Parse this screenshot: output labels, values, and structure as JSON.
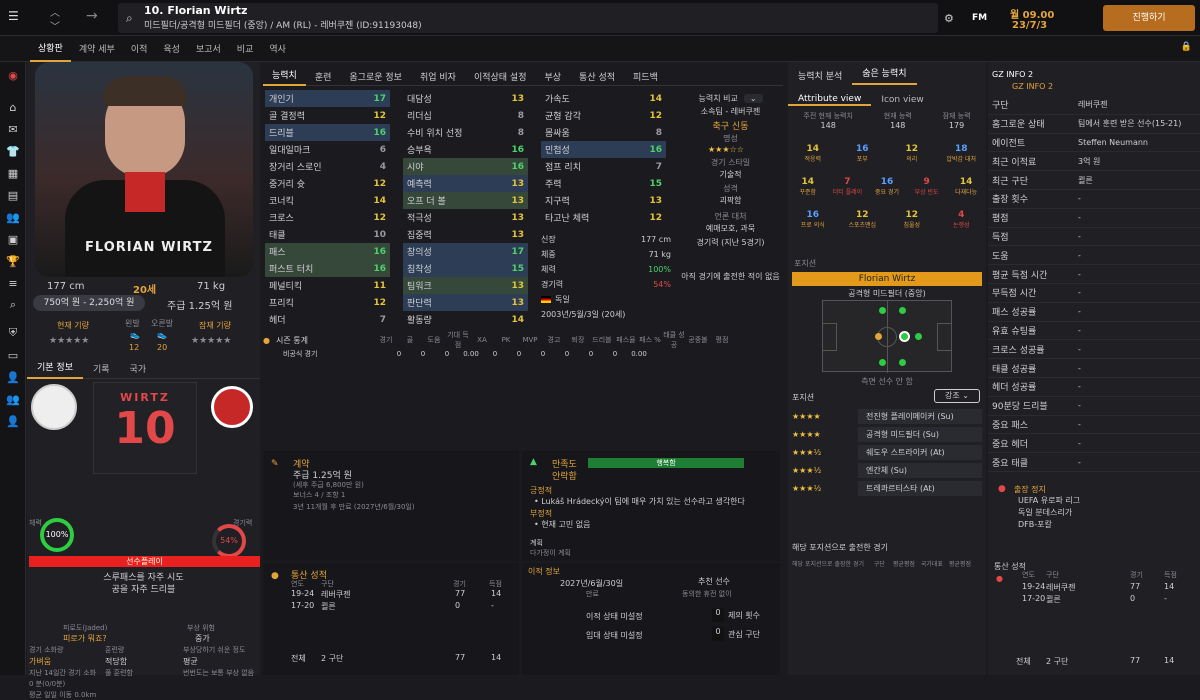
{
  "header": {
    "player_title": "10. Florian Wirtz",
    "subtitle": "미드필더/공격형 미드필더 (중앙) / AM (RL) - 레버쿠젠 (ID:91193048)",
    "fm_label": "FM",
    "date_line1": "월 09.00",
    "date_line2": "23/7/3",
    "continue_label": "진행하기"
  },
  "subnav": {
    "items": [
      "상황판",
      "계약 세부",
      "이적",
      "육성",
      "보고서",
      "비교",
      "역사"
    ]
  },
  "profile": {
    "height": "177 cm",
    "age": "20세",
    "weight": "71 kg",
    "value": "750억 원 - 2,250억 원",
    "wage": "주급 1.25억 원",
    "current_ability_label": "현재 기량",
    "foot_left_label": "왼발",
    "foot_right_label": "오른발",
    "foot_left_value": "12",
    "foot_right_value": "20",
    "potential_label": "잠재 기량",
    "name_on_shirt": "FLORIAN WIRTZ"
  },
  "profile_tabs": [
    "기본 정보",
    "기록",
    "국가"
  ],
  "kit": {
    "name": "WIRTZ",
    "number": "10"
  },
  "gauges": {
    "fitness_label": "체력",
    "fitness_value": "100%",
    "match_label": "경기력",
    "match_value": "54%",
    "status_bar": "선수플레이",
    "trait1": "스루패스를 자주 시도",
    "trait2": "공을 자주 드리블"
  },
  "misc": {
    "fatigue_label": "피로도(Jaded)",
    "fatigue_value": "피로가 뭐죠?",
    "injury_label": "부상 위험",
    "injury_value": "중가",
    "cond_label": "경기 소화량",
    "cond_value": "가벼움",
    "training_label": "훈련량",
    "training_value": "적당함",
    "injury_easy_label": "부상당하기 쉬운 정도",
    "injury_easy_value": "평균",
    "stat1": "지난 14일간 경기 소화",
    "stat2": "풀 훈련함",
    "stat3": "번번도는 보통 부상 없음",
    "stat4": "0 분(0/0분)",
    "stat5": "평균 일일 이동 0.0km"
  },
  "attr_tabs": [
    "능력치",
    "훈련",
    "옴그로운 정보",
    "취업 비자",
    "이적상태 설정",
    "부상",
    "통산 성적",
    "피드백"
  ],
  "technical": [
    {
      "name": "개인기",
      "value": "17",
      "hl": "blue"
    },
    {
      "name": "골 결정력",
      "value": "12",
      "hl": ""
    },
    {
      "name": "드리블",
      "value": "16",
      "hl": "blue"
    },
    {
      "name": "일대일마크",
      "value": "6",
      "hl": ""
    },
    {
      "name": "장거리 스로인",
      "value": "4",
      "hl": ""
    },
    {
      "name": "중거리 슛",
      "value": "12",
      "hl": ""
    },
    {
      "name": "코너킥",
      "value": "14",
      "hl": ""
    },
    {
      "name": "크로스",
      "value": "12",
      "hl": ""
    },
    {
      "name": "태클",
      "value": "10",
      "hl": ""
    },
    {
      "name": "패스",
      "value": "16",
      "hl": "green"
    },
    {
      "name": "퍼스트 터치",
      "value": "16",
      "hl": "green"
    },
    {
      "name": "페널티킥",
      "value": "11",
      "hl": ""
    },
    {
      "name": "프리킥",
      "value": "12",
      "hl": ""
    },
    {
      "name": "헤더",
      "value": "7",
      "hl": ""
    }
  ],
  "mental": [
    {
      "name": "대담성",
      "value": "13",
      "hl": ""
    },
    {
      "name": "리더십",
      "value": "8",
      "hl": ""
    },
    {
      "name": "수비 위치 선정",
      "value": "8",
      "hl": ""
    },
    {
      "name": "승부욕",
      "value": "16",
      "hl": ""
    },
    {
      "name": "시야",
      "value": "16",
      "hl": "green"
    },
    {
      "name": "예측력",
      "value": "13",
      "hl": "blue"
    },
    {
      "name": "오프 더 볼",
      "value": "13",
      "hl": "green"
    },
    {
      "name": "적극성",
      "value": "13",
      "hl": ""
    },
    {
      "name": "집중력",
      "value": "13",
      "hl": ""
    },
    {
      "name": "창의성",
      "value": "17",
      "hl": "blue"
    },
    {
      "name": "침착성",
      "value": "15",
      "hl": "blue"
    },
    {
      "name": "팀워크",
      "value": "13",
      "hl": "green"
    },
    {
      "name": "판단력",
      "value": "13",
      "hl": "blue"
    },
    {
      "name": "활동량",
      "value": "14",
      "hl": ""
    }
  ],
  "physical": [
    {
      "name": "가속도",
      "value": "14",
      "hl": ""
    },
    {
      "name": "균형 감각",
      "value": "12",
      "hl": ""
    },
    {
      "name": "몸싸움",
      "value": "8",
      "hl": ""
    },
    {
      "name": "민첩성",
      "value": "16",
      "hl": "blue"
    },
    {
      "name": "점프 리치",
      "value": "7",
      "hl": ""
    },
    {
      "name": "주력",
      "value": "15",
      "hl": ""
    },
    {
      "name": "지구력",
      "value": "13",
      "hl": ""
    },
    {
      "name": "타고난 체력",
      "value": "12",
      "hl": ""
    }
  ],
  "bio": {
    "height_label": "신장",
    "height": "177 cm",
    "weight_label": "체중",
    "weight": "71 kg",
    "fitness_label": "체력",
    "fitness": "100%",
    "form_label": "경기력",
    "form": "54%",
    "nation": "독일",
    "dob": "2003년/5월/3일 (20세)"
  },
  "compare": {
    "title": "능력치 비교",
    "club": "소속팀 - 레버쿠젠",
    "role": "축구 신동",
    "reputation_label": "명성",
    "style_label": "경기 스타일",
    "style": "기술적",
    "personality_label": "성격",
    "personality": "괴팍함",
    "media_label": "언론 대처",
    "media": "예매모호, 과묵",
    "form_label": "경기력 (지난 5경기)",
    "form_note": "아직 경기에 출전한 적이 없음"
  },
  "season": {
    "title": "시즌 통계",
    "cols": [
      "경기",
      "골",
      "도움",
      "기대 득점",
      "XA",
      "PK",
      "MVP",
      "경고",
      "퇴장",
      "드리블",
      "패스율",
      "패스 %",
      "태클 성공",
      "공중볼",
      "평점"
    ],
    "row_label": "비공식 경기",
    "values": [
      "0",
      "0",
      "0",
      "0.00",
      "0",
      "0",
      "0",
      "0",
      "0",
      "0",
      "0.00"
    ]
  },
  "contract": {
    "title": "계약",
    "wage": "주급 1.25억 원",
    "line1": "(세후 주급 6,800만 원)",
    "line2": "보너스 4 / 조항 1",
    "line3": "3년 11개월 후 만료 (2027년/6월/30일)"
  },
  "happiness": {
    "title": "만족도",
    "status": "행복함",
    "status2": "안락함",
    "pos_label": "긍정적",
    "pos_item": "Lukáš Hrádecký이 팀에 매우 가치 있는 선수라고 생각한다",
    "neg_label": "부정적",
    "neg_item": "현재 고민 없음",
    "plan_label": "계획",
    "plan": "다가정이 계획"
  },
  "career_mid": {
    "title": "통산 성적",
    "cols": [
      "연도",
      "구단",
      "경기",
      "득점"
    ],
    "rows": [
      {
        "year": "19-24",
        "club": "레버쿠젠",
        "apps": "77",
        "goals": "14"
      },
      {
        "year": "17-20",
        "club": "쾰른",
        "apps": "0",
        "goals": "-"
      }
    ],
    "total_label": "전체",
    "total_clubs": "2 구단",
    "total_apps": "77",
    "total_goals": "14"
  },
  "transfer": {
    "title": "이적 정보",
    "expiry": "2027년/6월/30일",
    "expiry_label": "만료",
    "recommended": "추천 선수",
    "rec_note": "동의한 휴전 없이",
    "status_label": "이적 상태 미설정",
    "loan_label": "임대 상태 미설정",
    "offers_label": "제의 횟수",
    "offers": "0",
    "interest_label": "관심 구단",
    "interest": "0"
  },
  "analysis": {
    "tabs": [
      "능력치 분석",
      "숨은 능력치"
    ],
    "view_tabs": [
      "Attribute view",
      "Icon view"
    ],
    "top": [
      {
        "label": "주전 현재 능력치",
        "value": "148"
      },
      {
        "label": "현재 능력",
        "value": "148"
      },
      {
        "label": "잠재 능력",
        "value": "179"
      }
    ],
    "grid1": [
      {
        "v": "14",
        "l": "적응력"
      },
      {
        "v": "16",
        "l": "포부"
      },
      {
        "v": "12",
        "l": "의리"
      },
      {
        "v": "18",
        "l": "압박감 대처"
      }
    ],
    "grid2": [
      {
        "v": "14",
        "l": "꾸준함"
      },
      {
        "v": "7",
        "l": "더티 플레이"
      },
      {
        "v": "16",
        "l": "중요 경기"
      },
      {
        "v": "9",
        "l": "부상 빈도"
      },
      {
        "v": "14",
        "l": "다재다능"
      }
    ],
    "grid3": [
      {
        "v": "16",
        "l": "프로 의식"
      },
      {
        "v": "12",
        "l": "스포츠맨십"
      },
      {
        "v": "12",
        "l": "침울성"
      },
      {
        "v": "4",
        "l": "논쟁성"
      }
    ]
  },
  "position": {
    "title": "포지션",
    "name": "Florian Wirtz",
    "role": "공격형 미드필더 (중앙)",
    "foot": "측면 선수 안 함",
    "roles_label": "포지션",
    "emphasis": "강조",
    "roles": [
      {
        "name": "전진형 플레이메이커 (Su)",
        "stars": "★★★★"
      },
      {
        "name": "공격형 미드필더 (Su)",
        "stars": "★★★★"
      },
      {
        "name": "쉐도우 스트라이커 (At)",
        "stars": "★★★½"
      },
      {
        "name": "엔간체 (Su)",
        "stars": "★★★½"
      },
      {
        "name": "트레콰르티스타 (At)",
        "stars": "★★★½"
      }
    ],
    "matches_label": "해당 포지션으로 출전한 경기",
    "matches_cols": [
      "해당 포지션으로 출장한 경기",
      "구단",
      "평균평점",
      "국가대표",
      "평균평점"
    ]
  },
  "info": {
    "title": "GZ INFO 2",
    "sub": "GZ INFO 2",
    "rows": [
      {
        "k": "구단",
        "v": "레버쿠젠"
      },
      {
        "k": "홈그로운 상태",
        "v": "팀에서 훈련 받은 선수(15-21)"
      },
      {
        "k": "에이전트",
        "v": "Steffen Neumann"
      },
      {
        "k": "최근 이적료",
        "v": "3억 원"
      },
      {
        "k": "최근 구단",
        "v": "쾰른"
      },
      {
        "k": "출장 횟수",
        "v": "-"
      },
      {
        "k": "평점",
        "v": "-"
      },
      {
        "k": "득점",
        "v": "-"
      },
      {
        "k": "도움",
        "v": "-"
      },
      {
        "k": "평균 득점 시간",
        "v": "-"
      },
      {
        "k": "무득점 시간",
        "v": "-"
      },
      {
        "k": "패스 성공률",
        "v": "-"
      },
      {
        "k": "유효 슈팅률",
        "v": "-"
      },
      {
        "k": "크로스 성공률",
        "v": "-"
      },
      {
        "k": "태클 성공률",
        "v": "-"
      },
      {
        "k": "헤더 성공률",
        "v": "-"
      },
      {
        "k": "90분당 드리블",
        "v": "-"
      },
      {
        "k": "중요 패스",
        "v": "-"
      },
      {
        "k": "중요 헤더",
        "v": "-"
      },
      {
        "k": "중요 태클",
        "v": "-"
      }
    ],
    "comp_title": "출장 정지",
    "comps": [
      "UEFA 유로파 리그",
      "독일 분데스리가",
      "DFB-포칼"
    ],
    "career_title": "통산 성적"
  }
}
